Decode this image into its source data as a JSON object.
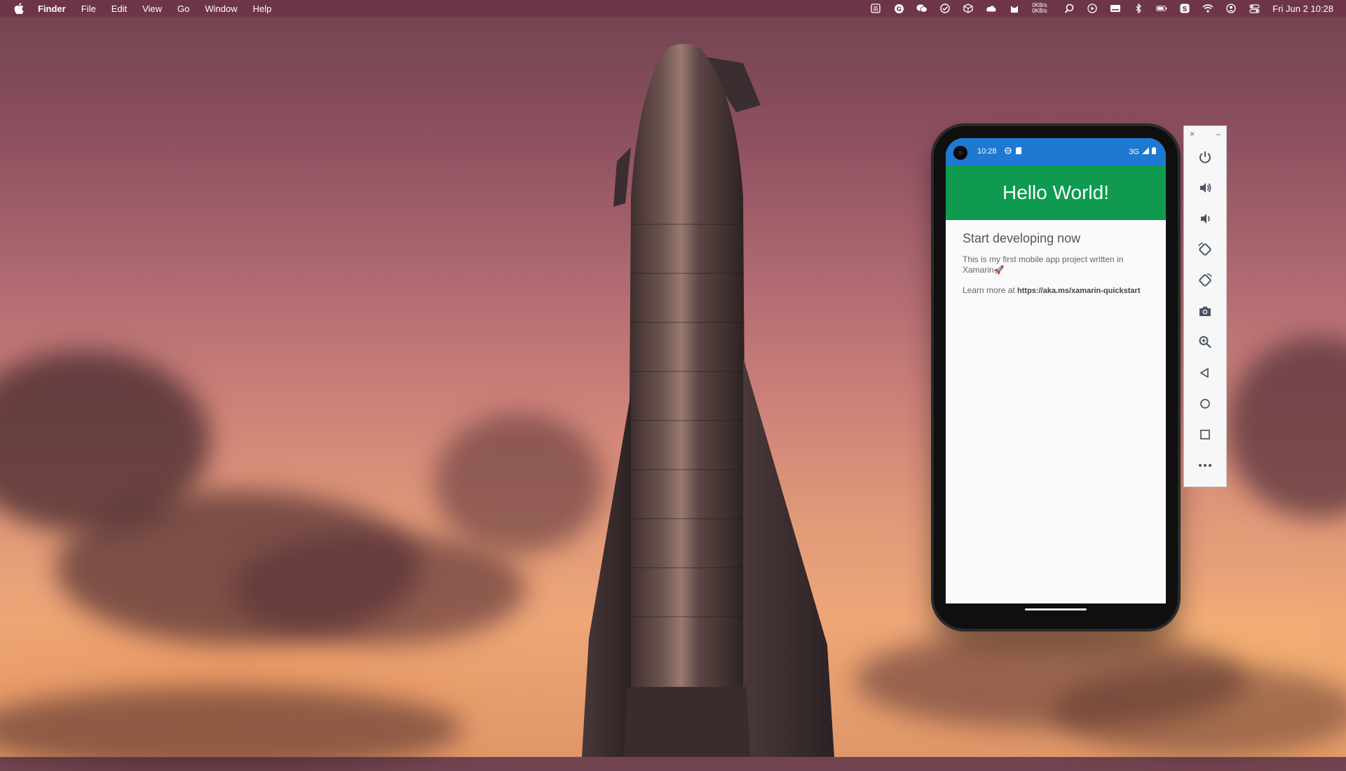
{
  "menubar": {
    "app_name": "Finder",
    "menus": [
      "File",
      "Edit",
      "View",
      "Go",
      "Window",
      "Help"
    ],
    "net_up": "0KB/s",
    "net_down": "0KB/s",
    "clock": "Fri Jun 2  10:28",
    "tray_icons": [
      "input-method-icon",
      "grammarly-icon",
      "wechat-icon",
      "checkmark-icon",
      "box-icon",
      "cloud-icon",
      "cat-icon",
      "search-icon",
      "play-icon",
      "keyboard-icon",
      "bluetooth-icon",
      "battery-icon",
      "s-app-icon",
      "wifi-icon",
      "user-icon",
      "control-center-icon"
    ]
  },
  "phone": {
    "status": {
      "time": "10:28",
      "network": "3G"
    },
    "app": {
      "title": "Hello World!",
      "heading": "Start developing now",
      "body": "This is my first mobile app project written in Xamarin🚀",
      "learn_prefix": "Learn more at ",
      "learn_url": "https://aka.ms/xamarin-quickstart"
    },
    "colors": {
      "status_bar": "#1e79d3",
      "app_bar": "#0f9a4f"
    }
  },
  "emulator_toolbar": {
    "close_label": "×",
    "minimize_label": "–",
    "buttons": [
      "power-icon",
      "volume-up-icon",
      "volume-down-icon",
      "rotate-left-icon",
      "rotate-right-icon",
      "camera-icon",
      "zoom-icon",
      "back-icon",
      "home-icon",
      "overview-icon",
      "more-icon"
    ]
  }
}
